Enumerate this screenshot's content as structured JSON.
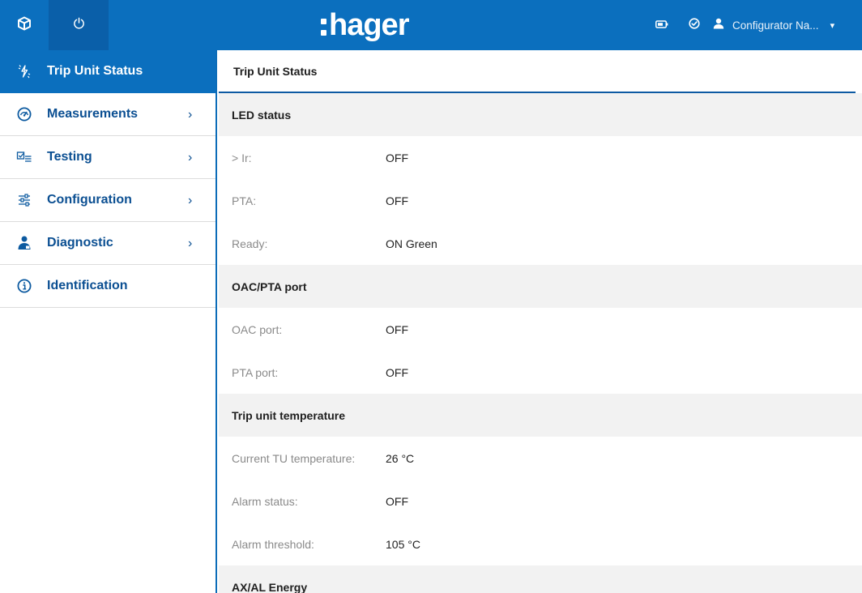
{
  "header": {
    "logo_text": "hager",
    "user_name": "Configurator Na...",
    "brand_color": "#0b6fbe",
    "icons": [
      "cube-icon",
      "power-icon",
      "battery-icon",
      "check-circle-icon",
      "user-icon",
      "chevron-down-icon"
    ]
  },
  "sidebar": {
    "items": [
      {
        "label": "Trip Unit Status",
        "icon": "trip-status-icon",
        "active": true
      },
      {
        "label": "Measurements",
        "icon": "gauge-icon",
        "chevron": "›"
      },
      {
        "label": "Testing",
        "icon": "checklist-icon",
        "chevron": "›"
      },
      {
        "label": "Configuration",
        "icon": "sliders-icon",
        "chevron": "›"
      },
      {
        "label": "Diagnostic",
        "icon": "technician-icon",
        "chevron": "›"
      },
      {
        "label": "Identification",
        "icon": "info-icon"
      }
    ]
  },
  "main": {
    "title": "Trip Unit Status",
    "sections": [
      {
        "title": "LED status",
        "rows": [
          {
            "label": "> Ir:",
            "value": "OFF"
          },
          {
            "label": "PTA:",
            "value": "OFF"
          },
          {
            "label": "Ready:",
            "value": "ON Green"
          }
        ]
      },
      {
        "title": "OAC/PTA port",
        "rows": [
          {
            "label": "OAC port:",
            "value": "OFF"
          },
          {
            "label": "PTA port:",
            "value": "OFF"
          }
        ]
      },
      {
        "title": "Trip unit temperature",
        "rows": [
          {
            "label": "Current TU temperature:",
            "value": "26 °C"
          },
          {
            "label": "Alarm status:",
            "value": "OFF"
          },
          {
            "label": "Alarm threshold:",
            "value": "105 °C"
          }
        ]
      },
      {
        "title": "AX/AL Energy",
        "rows": []
      }
    ]
  }
}
